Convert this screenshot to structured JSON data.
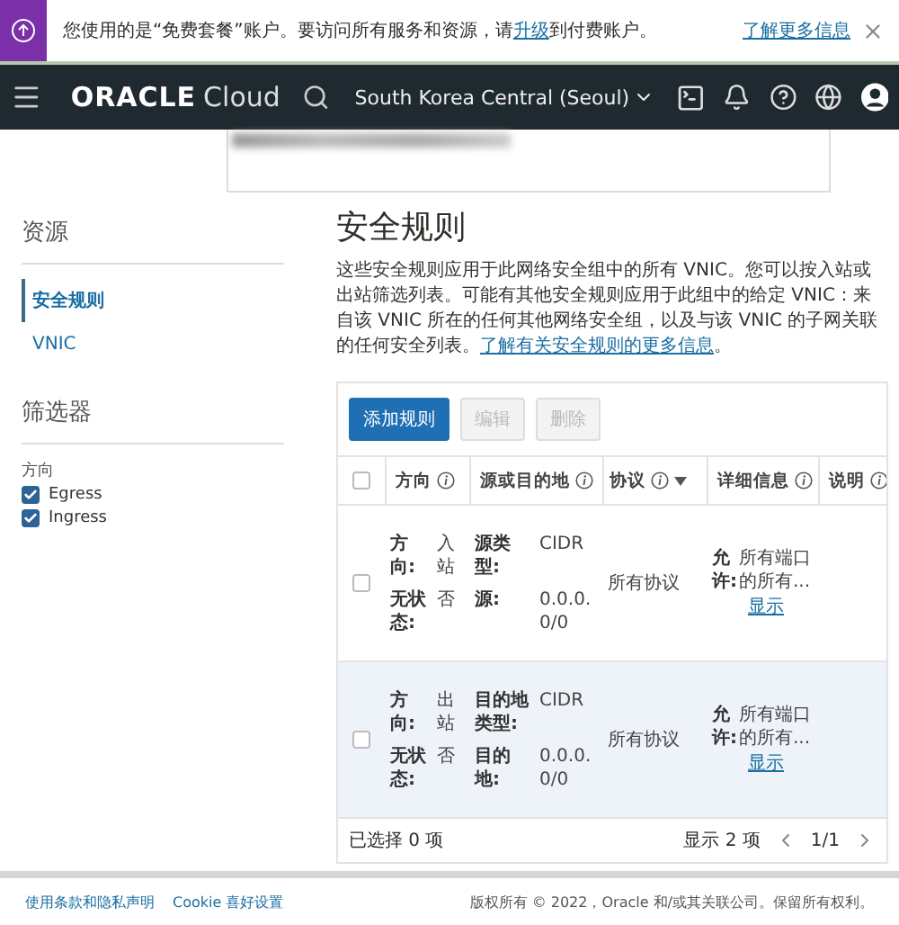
{
  "banner": {
    "before": "您使用的是“免费套餐”账户。要访问所有服务和资源，请",
    "link": "升级",
    "after": "到付费账户。",
    "more": "了解更多信息"
  },
  "navbar": {
    "brand": "ORACLE",
    "product": "Cloud",
    "region": "South Korea Central (Seoul)"
  },
  "sidebar": {
    "resources_title": "资源",
    "items": [
      {
        "label": "安全规则",
        "selected": true
      },
      {
        "label": "VNIC",
        "selected": false
      }
    ],
    "filters_title": "筛选器",
    "direction_label": "方向",
    "filters": [
      {
        "label": "Egress",
        "checked": true
      },
      {
        "label": "Ingress",
        "checked": true
      }
    ]
  },
  "main": {
    "title": "安全规则",
    "description": "这些安全规则应用于此网络安全组中的所有 VNIC。您可以按入站或出站筛选列表。可能有其他安全规则应用于此组中的给定 VNIC：来自该 VNIC 所在的任何其他网络安全组，以及与该 VNIC 的子网关联的任何安全列表。",
    "description_link": "了解有关安全规则的更多信息",
    "description_end": "。",
    "buttons": [
      {
        "label": "添加规则",
        "disabled": false
      },
      {
        "label": "编辑",
        "disabled": true
      },
      {
        "label": "删除",
        "disabled": true
      }
    ],
    "table": {
      "header_checked": false,
      "columns": [
        {
          "label": "方向",
          "sortable": false
        },
        {
          "label": "源或目的地",
          "sortable": false
        },
        {
          "label": "协议",
          "sortable": true
        },
        {
          "label": "详细信息",
          "sortable": false
        },
        {
          "label": "说明",
          "sortable": false
        }
      ],
      "rows": [
        {
          "selected": false,
          "checked": false,
          "direction": {
            "label": "方向:",
            "value": "入站"
          },
          "stateless": {
            "label": "无状态:",
            "value": "否"
          },
          "endpoint": [
            {
              "label": "源类型:",
              "value": "CIDR"
            },
            {
              "label": "源:",
              "value": "0.0.0.0/0"
            }
          ],
          "protocol": "所有协议",
          "details": {
            "label": "允许:",
            "value": "所有端口的所有..."
          },
          "link": "显示"
        },
        {
          "selected": true,
          "checked": false,
          "direction": {
            "label": "方向:",
            "value": "出站"
          },
          "stateless": {
            "label": "无状态:",
            "value": "否"
          },
          "endpoint": [
            {
              "label": "目的地类型:",
              "value": "CIDR"
            },
            {
              "label": "目的地:",
              "value": "0.0.0.0/0"
            }
          ],
          "protocol": "所有协议",
          "details": {
            "label": "允许:",
            "value": "所有端口的所有..."
          },
          "link": "显示"
        }
      ],
      "selected_count": "已选择 0 项",
      "shown_count": "显示 2 项",
      "page": "1/1"
    }
  },
  "footer": {
    "links": [
      "使用条款和隐私声明",
      "Cookie 喜好设置"
    ],
    "copyright": "版权所有 © 2022，Oracle 和/或其关联公司。保留所有权利。"
  }
}
